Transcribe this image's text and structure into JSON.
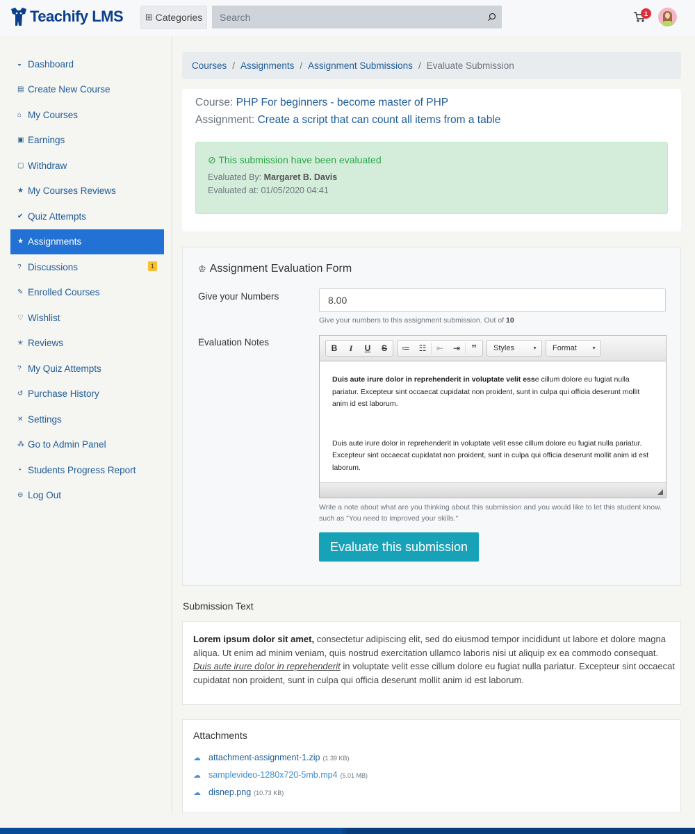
{
  "header": {
    "brand": "Teachify LMS",
    "categories_label": "Categories",
    "search_placeholder": "Search",
    "cart_count": "1"
  },
  "sidebar": {
    "items": [
      {
        "label": "Dashboard",
        "icon": "dashboard-icon"
      },
      {
        "label": "Create New Course",
        "icon": "create-course-icon"
      },
      {
        "label": "My Courses",
        "icon": "graduation-cap-icon"
      },
      {
        "label": "Earnings",
        "icon": "money-icon"
      },
      {
        "label": "Withdraw",
        "icon": "wallet-icon"
      },
      {
        "label": "My Courses Reviews",
        "icon": "star-icon"
      },
      {
        "label": "Quiz Attempts",
        "icon": "double-check-icon"
      },
      {
        "label": "Assignments",
        "icon": "star-icon",
        "active": true
      },
      {
        "label": "Discussions",
        "icon": "question-icon",
        "badge": "1"
      },
      {
        "label": "Enrolled Courses",
        "icon": "edit-icon"
      },
      {
        "label": "Wishlist",
        "icon": "heart-icon"
      },
      {
        "label": "Reviews",
        "icon": "star-half-icon"
      },
      {
        "label": "My Quiz Attempts",
        "icon": "question-icon"
      },
      {
        "label": "Purchase History",
        "icon": "history-icon"
      },
      {
        "label": "Settings",
        "icon": "tools-icon"
      },
      {
        "label": "Go to Admin Panel",
        "icon": "network-icon"
      },
      {
        "label": "Students Progress Report",
        "icon": "chart-pie-icon"
      },
      {
        "label": "Log Out",
        "icon": "logout-icon"
      }
    ]
  },
  "breadcrumb": {
    "items": [
      "Courses",
      "Assignments",
      "Assignment Submissions"
    ],
    "current": "Evaluate Submission"
  },
  "info": {
    "course_label": "Course:",
    "course_name": "PHP For beginners - become master of PHP",
    "assignment_label": "Assignment:",
    "assignment_name": "Create a script that can count all items from a table",
    "alert_title": "This submission have been evaluated",
    "evaluated_by_label": "Evaluated By:",
    "evaluated_by": "Margaret B. Davis",
    "evaluated_at_label": "Evaluated at:",
    "evaluated_at": "01/05/2020 04:41"
  },
  "form": {
    "title": "Assignment Evaluation Form",
    "numbers_label": "Give your Numbers",
    "numbers_value": "8.00",
    "numbers_help": "Give your numbers to this assignment submission. Out of",
    "numbers_max": "10",
    "notes_label": "Evaluation Notes",
    "toolbar": {
      "bold": "B",
      "italic": "I",
      "underline": "U",
      "strike": "S",
      "styles": "Styles",
      "format": "Format"
    },
    "notes_p1_bold": "Duis aute irure dolor in reprehenderit in voluptate velit ess",
    "notes_p1_rest": "e cillum dolore eu fugiat nulla pariatur. Excepteur sint occaecat cupidatat non proident, sunt in culpa qui officia deserunt mollit anim id est laborum.",
    "notes_p2": "Duis aute irure dolor in reprehenderit in voluptate velit esse cillum dolore eu fugiat nulla pariatur. Excepteur sint occaecat cupidatat non proident, sunt in culpa qui officia deserunt mollit anim id est laborum.",
    "notes_help": "Write a note about what are you thinking about this submission and you would like to let this student know. such as \"You need to improved your skills.\"",
    "submit_label": "Evaluate this submission"
  },
  "submission": {
    "title": "Submission Text",
    "bold": "Lorem ipsum dolor sit amet,",
    "part1": " consectetur adipiscing elit, sed do eiusmod tempor incididunt ut labore et dolore magna aliqua. Ut enim ad minim veniam, quis nostrud exercitation ullamco laboris nisi ut aliquip ex ea commodo consequat. ",
    "underlined": "Duis aute irure dolor in reprehenderit",
    "part2": " in voluptate velit esse cillum dolore eu fugiat nulla pariatur. Excepteur sint occaecat cupidatat non proident, sunt in culpa qui officia deserunt mollit anim id est laborum."
  },
  "attachments": {
    "title": "Attachments",
    "files": [
      {
        "name": "attachment-assignment-1.zip",
        "size": "(1.39 KB)"
      },
      {
        "name": "samplevideo-1280x720-5mb.mp4",
        "size": "(5.01 MB)"
      },
      {
        "name": "disnep.png",
        "size": "(10.73 KB)"
      }
    ]
  }
}
